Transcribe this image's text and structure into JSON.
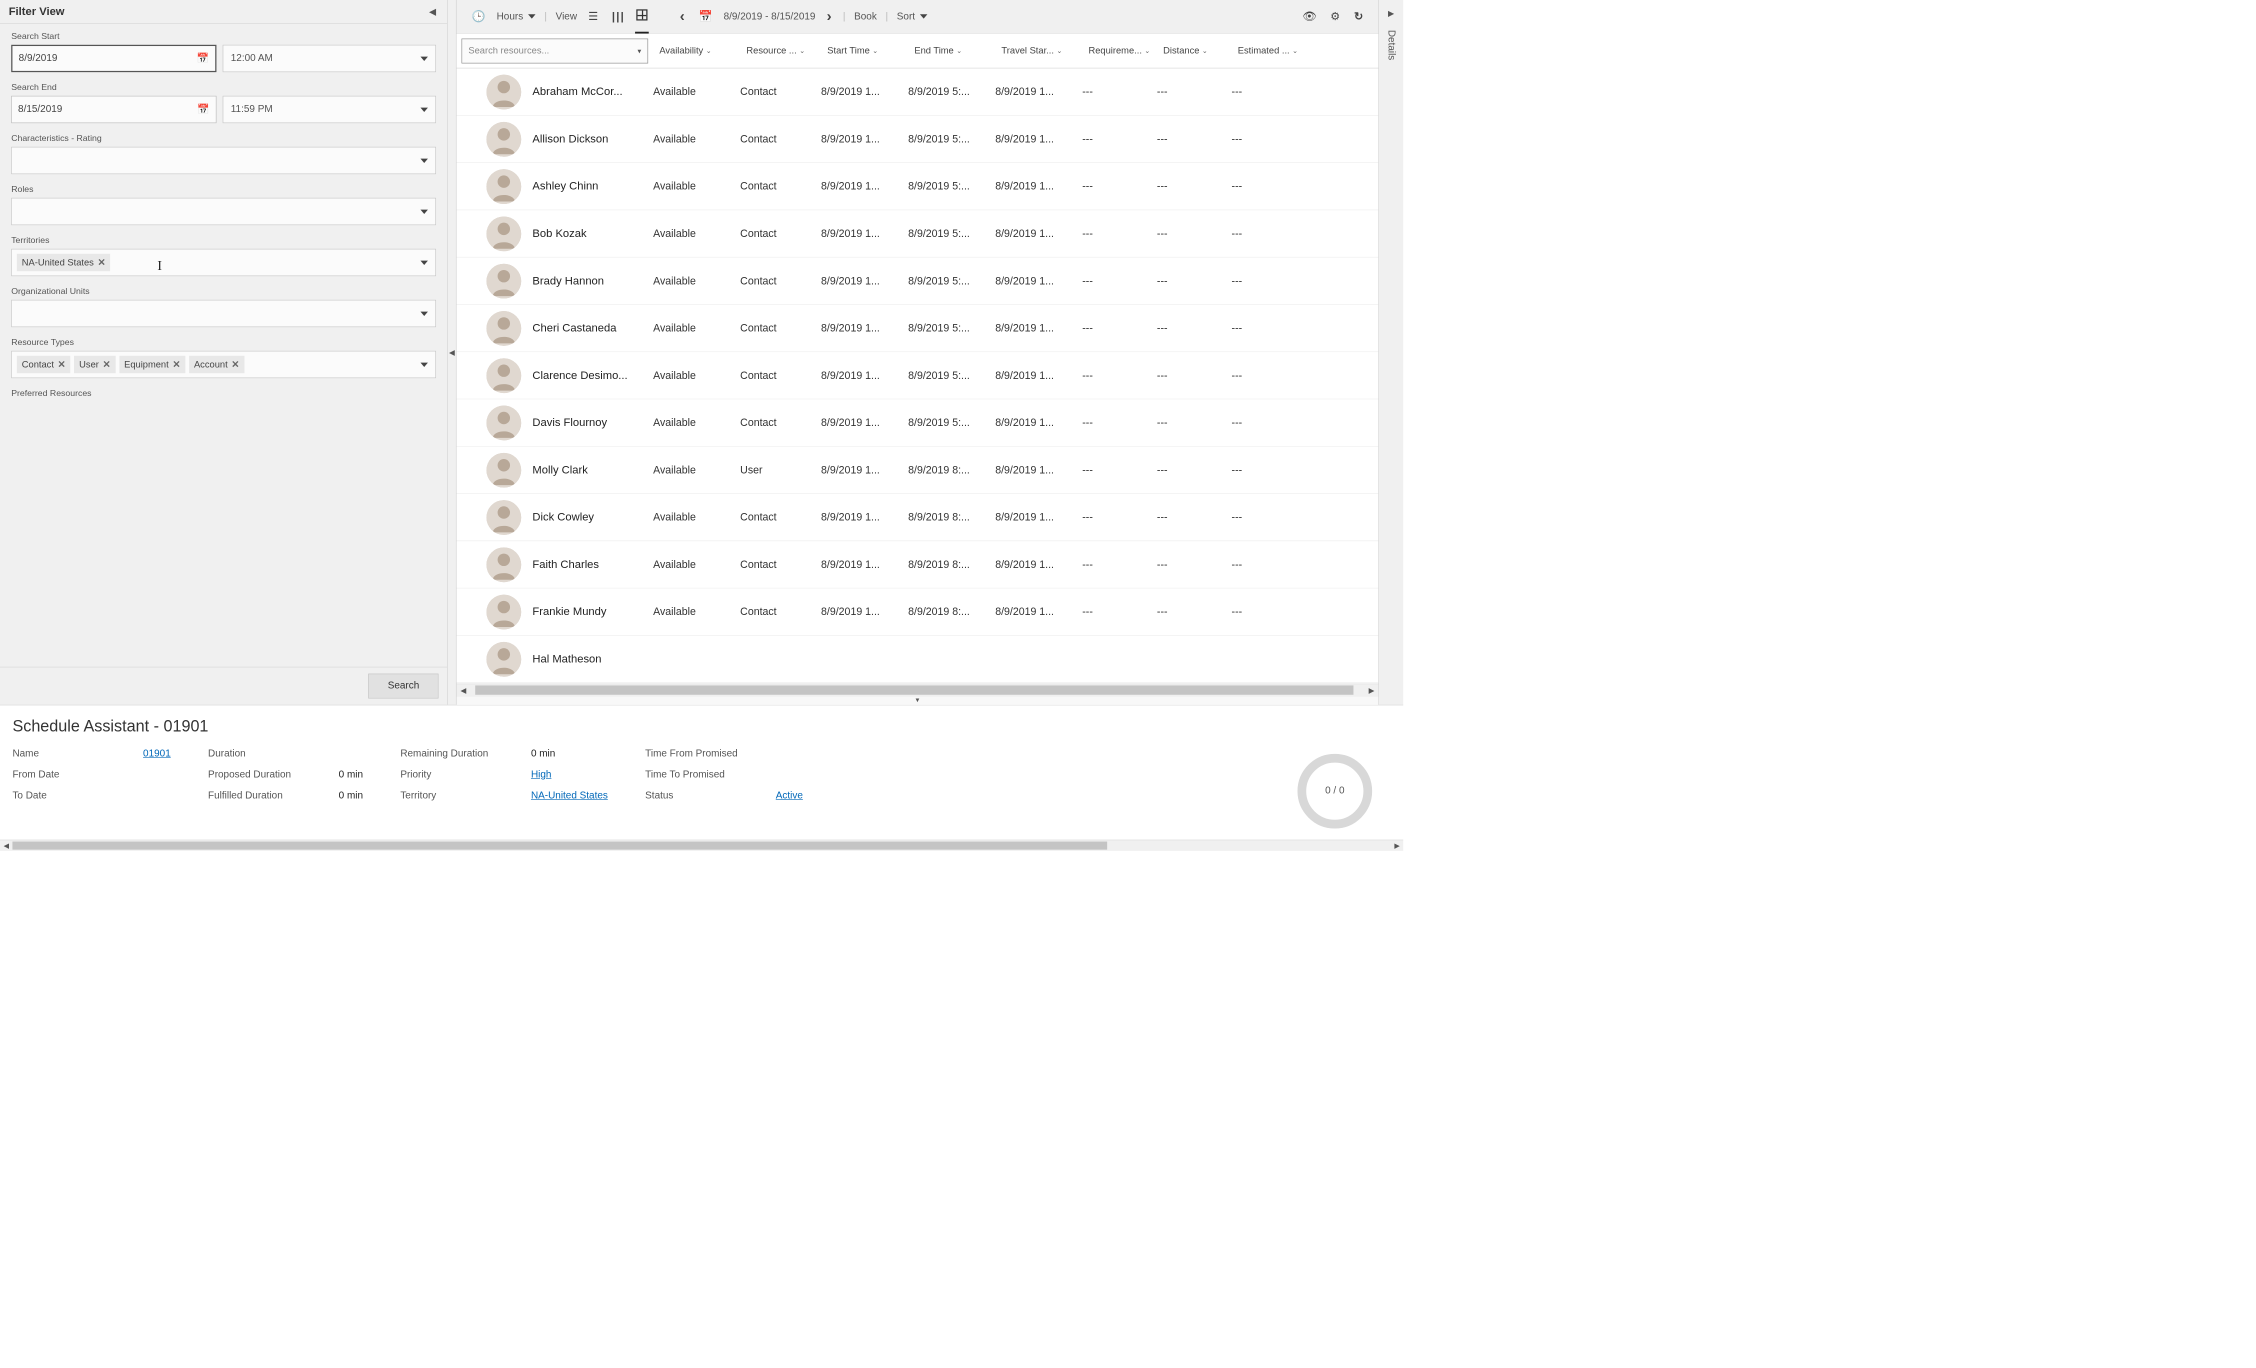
{
  "filter": {
    "title": "Filter View",
    "search_start_label": "Search Start",
    "search_start_date": "8/9/2019",
    "search_start_time": "12:00 AM",
    "search_end_label": "Search End",
    "search_end_date": "8/15/2019",
    "search_end_time": "11:59 PM",
    "characteristics_label": "Characteristics - Rating",
    "roles_label": "Roles",
    "territories_label": "Territories",
    "territories_tags": [
      "NA-United States"
    ],
    "org_units_label": "Organizational Units",
    "resource_types_label": "Resource Types",
    "resource_types_tags": [
      "Contact",
      "User",
      "Equipment",
      "Account"
    ],
    "preferred_resources_label": "Preferred Resources",
    "search_button": "Search"
  },
  "toolbar": {
    "hours_label": "Hours",
    "view_label": "View",
    "date_range": "8/9/2019 - 8/15/2019",
    "book_label": "Book",
    "sort_label": "Sort"
  },
  "grid": {
    "search_placeholder": "Search resources...",
    "columns": {
      "availability": "Availability",
      "resource_type": "Resource ...",
      "start_time": "Start Time",
      "end_time": "End Time",
      "travel_start": "Travel Star...",
      "requirement": "Requireme...",
      "distance": "Distance",
      "estimated": "Estimated ..."
    },
    "rows": [
      {
        "name": "Abraham McCor...",
        "avail": "Available",
        "type": "Contact",
        "start": "8/9/2019 1...",
        "end": "8/9/2019 5:...",
        "travel": "8/9/2019 1...",
        "req": "---",
        "dist": "---",
        "est": "---"
      },
      {
        "name": "Allison Dickson",
        "avail": "Available",
        "type": "Contact",
        "start": "8/9/2019 1...",
        "end": "8/9/2019 5:...",
        "travel": "8/9/2019 1...",
        "req": "---",
        "dist": "---",
        "est": "---"
      },
      {
        "name": "Ashley Chinn",
        "avail": "Available",
        "type": "Contact",
        "start": "8/9/2019 1...",
        "end": "8/9/2019 5:...",
        "travel": "8/9/2019 1...",
        "req": "---",
        "dist": "---",
        "est": "---"
      },
      {
        "name": "Bob Kozak",
        "avail": "Available",
        "type": "Contact",
        "start": "8/9/2019 1...",
        "end": "8/9/2019 5:...",
        "travel": "8/9/2019 1...",
        "req": "---",
        "dist": "---",
        "est": "---"
      },
      {
        "name": "Brady Hannon",
        "avail": "Available",
        "type": "Contact",
        "start": "8/9/2019 1...",
        "end": "8/9/2019 5:...",
        "travel": "8/9/2019 1...",
        "req": "---",
        "dist": "---",
        "est": "---"
      },
      {
        "name": "Cheri Castaneda",
        "avail": "Available",
        "type": "Contact",
        "start": "8/9/2019 1...",
        "end": "8/9/2019 5:...",
        "travel": "8/9/2019 1...",
        "req": "---",
        "dist": "---",
        "est": "---"
      },
      {
        "name": "Clarence Desimo...",
        "avail": "Available",
        "type": "Contact",
        "start": "8/9/2019 1...",
        "end": "8/9/2019 5:...",
        "travel": "8/9/2019 1...",
        "req": "---",
        "dist": "---",
        "est": "---"
      },
      {
        "name": "Davis Flournoy",
        "avail": "Available",
        "type": "Contact",
        "start": "8/9/2019 1...",
        "end": "8/9/2019 5:...",
        "travel": "8/9/2019 1...",
        "req": "---",
        "dist": "---",
        "est": "---"
      },
      {
        "name": "Molly Clark",
        "avail": "Available",
        "type": "User",
        "start": "8/9/2019 1...",
        "end": "8/9/2019 8:...",
        "travel": "8/9/2019 1...",
        "req": "---",
        "dist": "---",
        "est": "---"
      },
      {
        "name": "Dick Cowley",
        "avail": "Available",
        "type": "Contact",
        "start": "8/9/2019 1...",
        "end": "8/9/2019 8:...",
        "travel": "8/9/2019 1...",
        "req": "---",
        "dist": "---",
        "est": "---"
      },
      {
        "name": "Faith Charles",
        "avail": "Available",
        "type": "Contact",
        "start": "8/9/2019 1...",
        "end": "8/9/2019 8:...",
        "travel": "8/9/2019 1...",
        "req": "---",
        "dist": "---",
        "est": "---"
      },
      {
        "name": "Frankie Mundy",
        "avail": "Available",
        "type": "Contact",
        "start": "8/9/2019 1...",
        "end": "8/9/2019 8:...",
        "travel": "8/9/2019 1...",
        "req": "---",
        "dist": "---",
        "est": "---"
      },
      {
        "name": "Hal Matheson",
        "avail": "",
        "type": "",
        "start": "",
        "end": "",
        "travel": "",
        "req": "",
        "dist": "",
        "est": ""
      }
    ]
  },
  "details_tab": "Details",
  "bottom": {
    "title": "Schedule Assistant - 01901",
    "name_label": "Name",
    "name_value": "01901",
    "from_label": "From Date",
    "from_value": "",
    "to_label": "To Date",
    "to_value": "",
    "duration_label": "Duration",
    "duration_value": "",
    "proposed_label": "Proposed Duration",
    "proposed_value": "0 min",
    "fulfilled_label": "Fulfilled Duration",
    "fulfilled_value": "0 min",
    "remaining_label": "Remaining Duration",
    "remaining_value": "0 min",
    "priority_label": "Priority",
    "priority_value": "High",
    "territory_label": "Territory",
    "territory_value": "NA-United States",
    "time_from_label": "Time From Promised",
    "time_from_value": "",
    "time_to_label": "Time To Promised",
    "time_to_value": "",
    "status_label": "Status",
    "status_value": "Active",
    "donut_text": "0 / 0"
  }
}
